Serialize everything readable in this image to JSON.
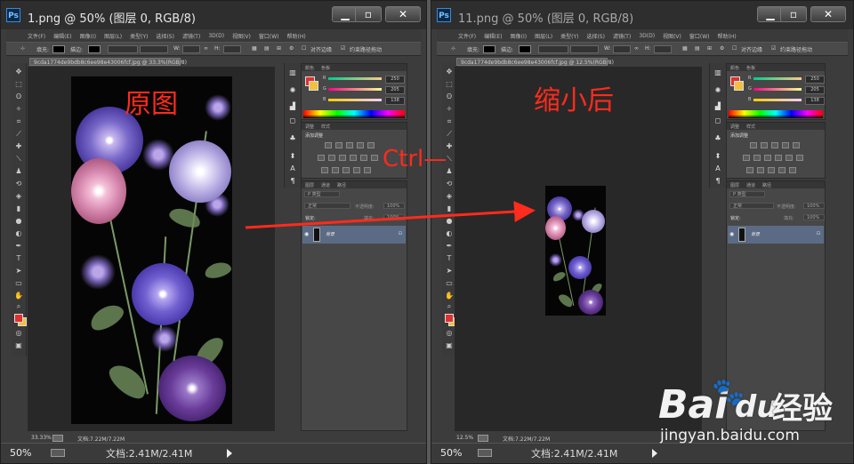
{
  "left_window": {
    "title": "1.png @ 50% (图层 0, RGB/8)",
    "app_logo": "Ps",
    "doc_tab": "9cda1774de9bdb8c6ee98e43006fcf.jpg @ 33.3%(RGB/8)",
    "status_zoom": "33.33%",
    "status_doc": "文档:7.22M/7.22M",
    "bottom_zoom": "50%",
    "bottom_doc": "文档:2.41M/2.41M"
  },
  "right_window": {
    "title": "11.png @ 50% (图层 0, RGB/8)",
    "app_logo": "Ps",
    "doc_tab": "9cda1774de9bdb8c6ee98e43006fcf.jpg @ 12.5%(RGB/8)",
    "status_zoom": "12.5%",
    "status_doc": "文档:7.22M/7.22M",
    "bottom_zoom": "50%",
    "bottom_doc": "文档:2.41M/2.41M"
  },
  "menu": [
    "文件(F)",
    "编辑(E)",
    "图像(I)",
    "图层(L)",
    "类型(Y)",
    "选择(S)",
    "滤镜(T)",
    "3D(D)",
    "视图(V)",
    "窗口(W)",
    "帮助(H)"
  ],
  "options_bar": {
    "fill_label": "填充:",
    "stroke_label": "描边:",
    "w_label": "W:",
    "h_label": "H:",
    "align_edges": "对齐边缘",
    "constrain": "约束路径拖动"
  },
  "color_panel": {
    "tabs": [
      "颜色",
      "色板"
    ],
    "r_label": "R",
    "g_label": "G",
    "b_label": "B",
    "r_value": "250",
    "g_value": "205",
    "b_value": "138"
  },
  "adjust_panel": {
    "tabs": [
      "调整",
      "样式"
    ],
    "add_label": "添加调整"
  },
  "layers_panel": {
    "tabs": [
      "图层",
      "通道",
      "路径"
    ],
    "kind": "P 类型",
    "mode": "正常",
    "opacity_label": "不透明度:",
    "opacity_value": "100%",
    "lock_label": "锁定:",
    "fill_label": "填充:",
    "fill_value": "100%",
    "layer_name": "背景",
    "lock_icon": "lock-icon"
  },
  "annotations": {
    "original": "原图",
    "shrunk": "缩小后",
    "shortcut": "Ctrl—"
  },
  "watermark": {
    "brand": "Bai",
    "brand2": "du",
    "brand3": "经验",
    "url": "jingyan.baidu.com"
  },
  "colors": {
    "annotation": "#ff2b1c",
    "fg_swatch": "#e03030",
    "bg_swatch": "#f0c040",
    "selected_layer": "#5b6b85"
  }
}
